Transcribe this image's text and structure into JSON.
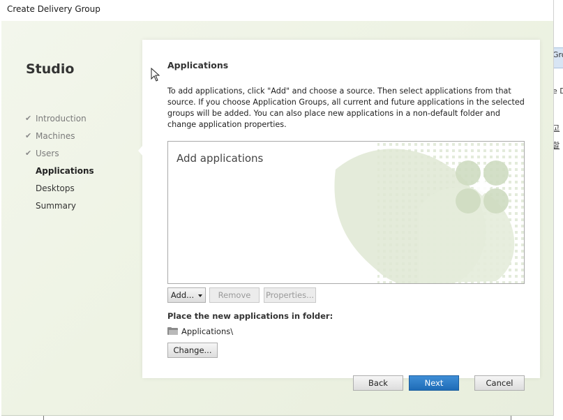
{
  "window": {
    "title": "Create Delivery Group"
  },
  "sidebar": {
    "brand": "Studio",
    "steps": [
      {
        "label": "Introduction",
        "state": "done"
      },
      {
        "label": "Machines",
        "state": "done"
      },
      {
        "label": "Users",
        "state": "done"
      },
      {
        "label": "Applications",
        "state": "current"
      },
      {
        "label": "Desktops",
        "state": "pending"
      },
      {
        "label": "Summary",
        "state": "pending"
      }
    ],
    "check_icon": "check-icon"
  },
  "main": {
    "heading": "Applications",
    "description": "To add applications, click \"Add\" and choose a source. Then select applications from that source. If you choose Application Groups, all current and future applications in the selected groups will be added. You can also place new applications in a non-default folder and change application properties.",
    "apps_list": {
      "empty_text": "Add applications",
      "items": []
    },
    "buttons": {
      "add": "Add...",
      "remove": "Remove",
      "properties": "Properties..."
    },
    "folder": {
      "label": "Place the new applications in folder:",
      "path": "Applications\\",
      "icon": "folder-icon",
      "change": "Change..."
    }
  },
  "footer": {
    "back": "Back",
    "next": "Next",
    "cancel": "Cancel"
  },
  "background_window": {
    "fragments": [
      "Gro",
      "e D",
      "고",
      "할"
    ]
  },
  "colors": {
    "accent": "#2c7bc6",
    "dialog_bg": "#eef3e4",
    "watermark": "#dfe8d3"
  }
}
